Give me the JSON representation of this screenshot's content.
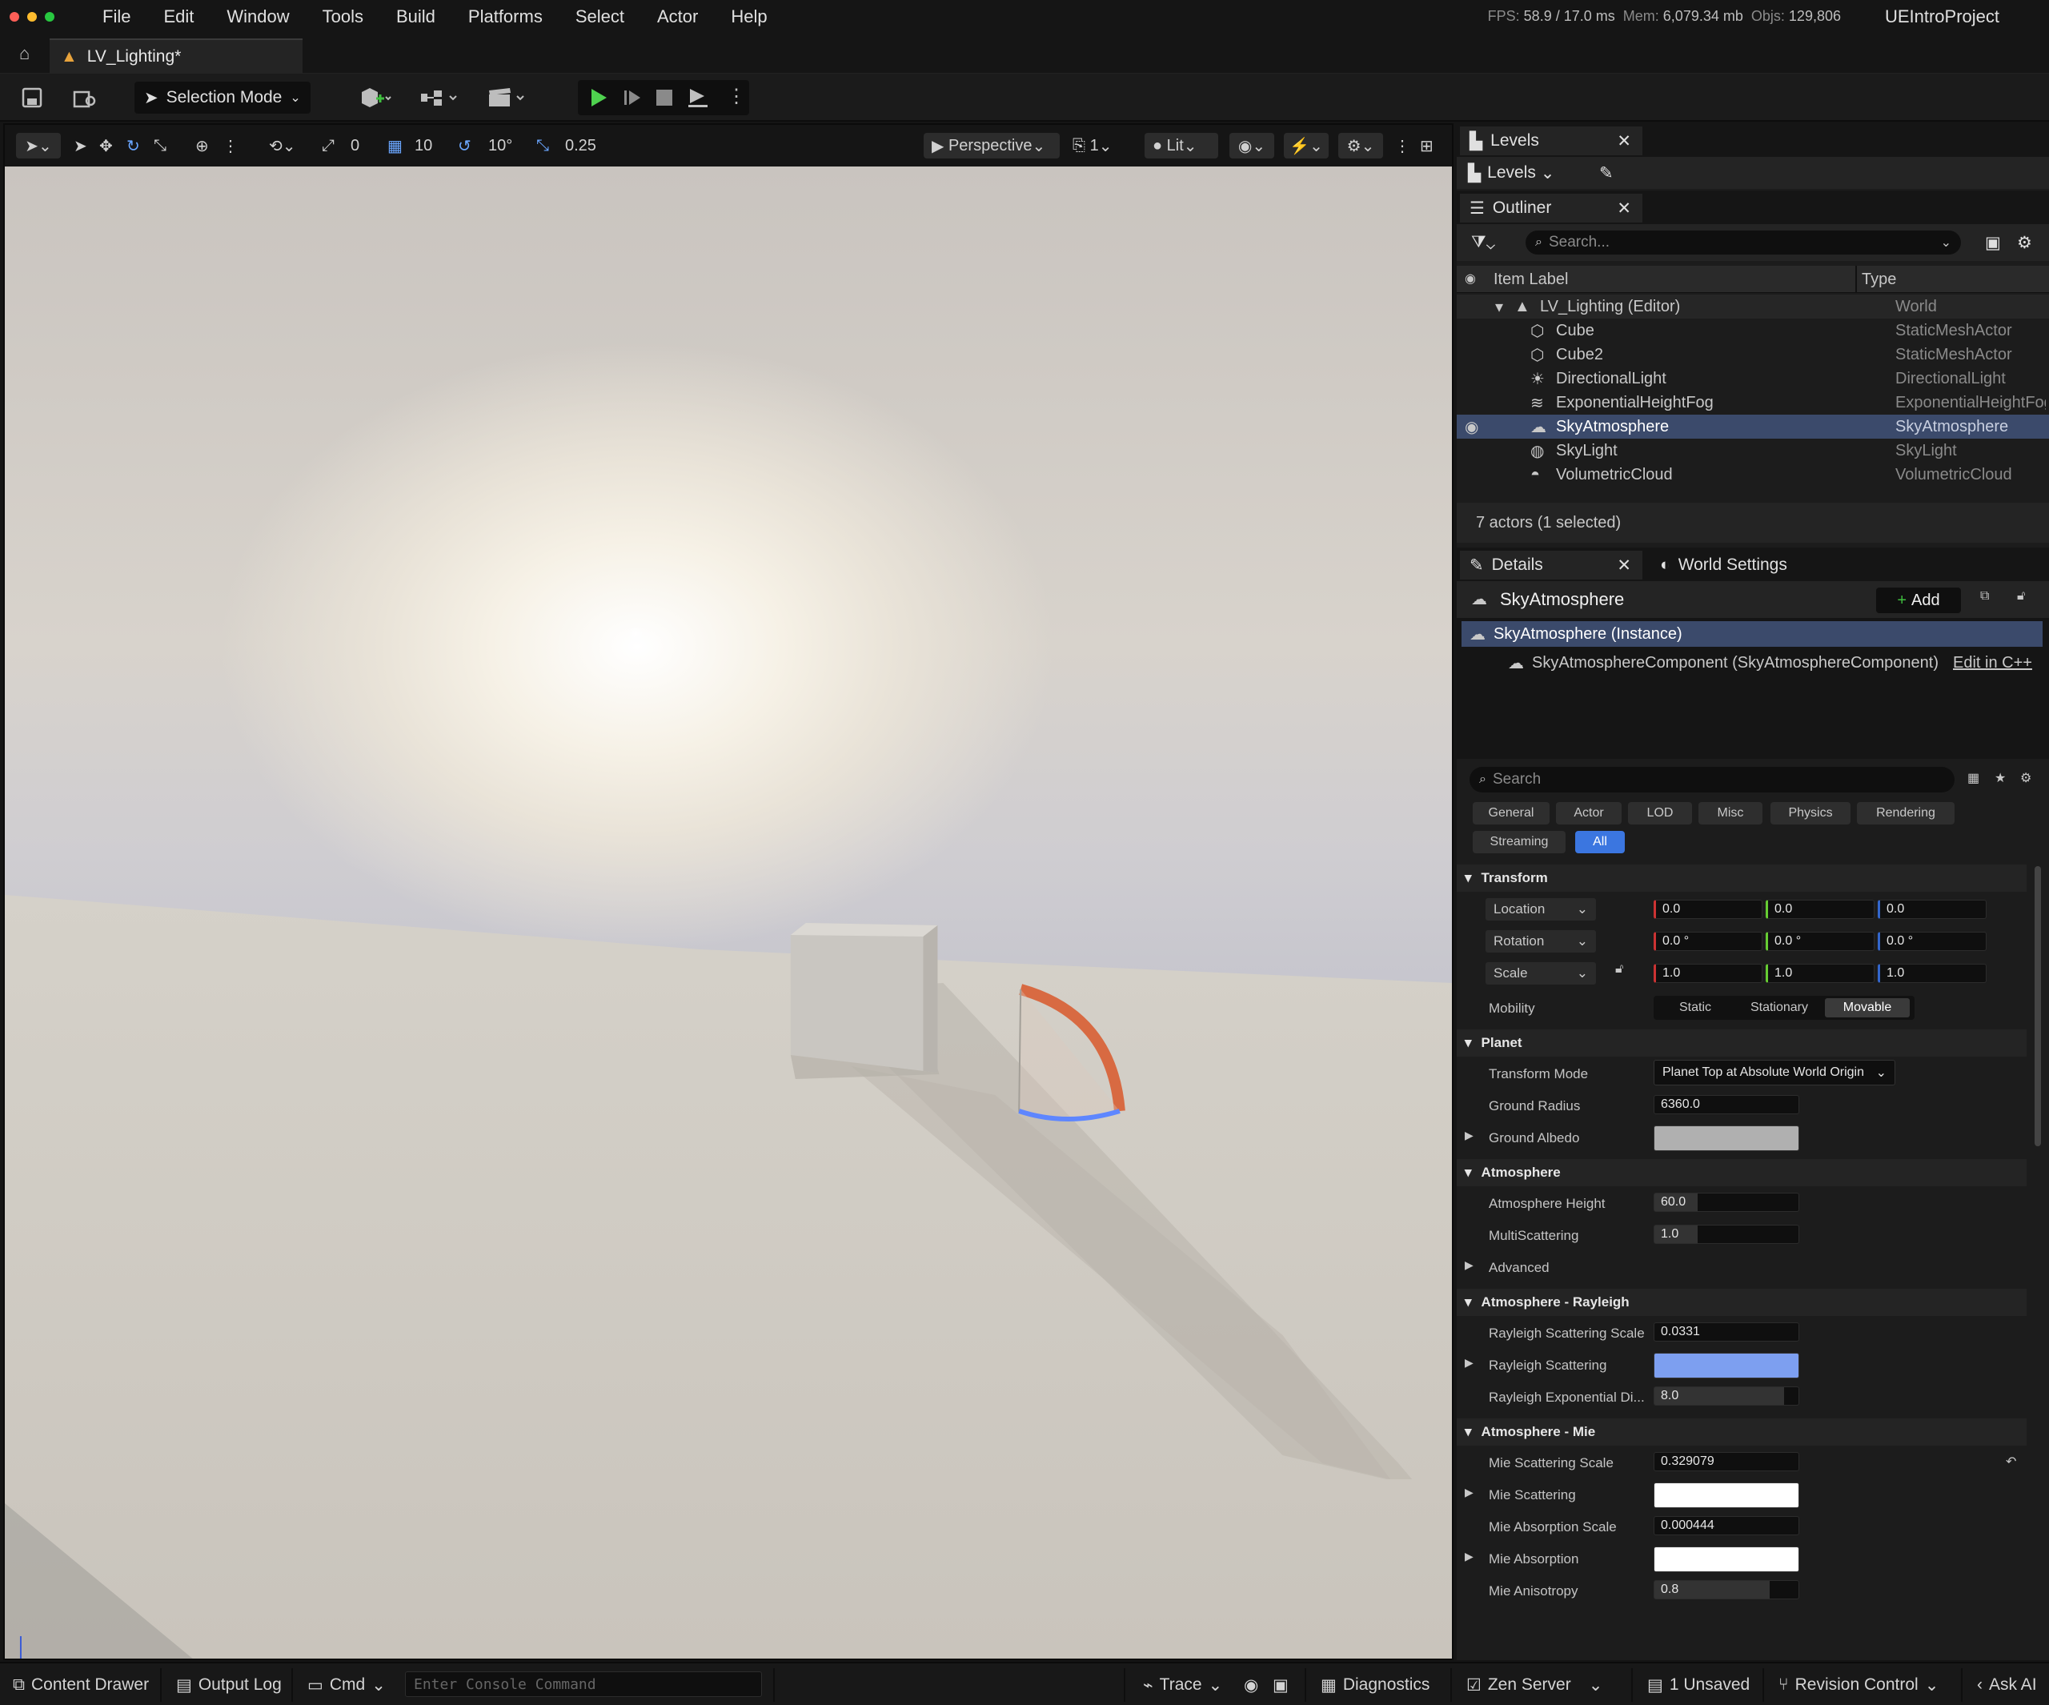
{
  "menu": {
    "items": [
      "File",
      "Edit",
      "Window",
      "Tools",
      "Build",
      "Platforms",
      "Select",
      "Actor",
      "Help"
    ],
    "stats": {
      "fps_label": "FPS:",
      "fps": "58.9",
      "frame": "/ 17.0 ms",
      "mem_label": "Mem:",
      "mem": "6,079.34 mb",
      "objs_label": "Objs:",
      "objs": "129,806"
    },
    "project": "UEIntroProject"
  },
  "tab": {
    "title": "LV_Lighting*"
  },
  "toolbar": {
    "selection_mode": "Selection Mode"
  },
  "viewport": {
    "rot_snap": "0",
    "grid_snap": "10",
    "angle_snap": "10°",
    "scale_snap": "0.25",
    "view_mode": "Perspective",
    "cam_speed": "1",
    "lighting": "Lit"
  },
  "levels": {
    "tab": "Levels",
    "dropdown": "Levels"
  },
  "outliner": {
    "tab": "Outliner",
    "search_placeholder": "Search...",
    "col_label": "Item Label",
    "col_type": "Type",
    "rows": [
      {
        "label": "LV_Lighting (Editor)",
        "type": "World"
      },
      {
        "label": "Cube",
        "type": "StaticMeshActor"
      },
      {
        "label": "Cube2",
        "type": "StaticMeshActor"
      },
      {
        "label": "DirectionalLight",
        "type": "DirectionalLight"
      },
      {
        "label": "ExponentialHeightFog",
        "type": "ExponentialHeightFog"
      },
      {
        "label": "SkyAtmosphere",
        "type": "SkyAtmosphere"
      },
      {
        "label": "SkyLight",
        "type": "SkyLight"
      },
      {
        "label": "VolumetricCloud",
        "type": "VolumetricCloud"
      }
    ],
    "footer": "7 actors (1 selected)"
  },
  "details": {
    "tab": "Details",
    "world_tab": "World Settings",
    "actor": "SkyAtmosphere",
    "add": "Add",
    "instance": "SkyAtmosphere (Instance)",
    "component": "SkyAtmosphereComponent (SkyAtmosphereComponent)",
    "edit_cpp": "Edit in C++",
    "search_placeholder": "Search",
    "filters": [
      "General",
      "Actor",
      "LOD",
      "Misc",
      "Physics",
      "Rendering",
      "Streaming",
      "All"
    ],
    "transform": {
      "title": "Transform",
      "location": "Location",
      "rotation": "Rotation",
      "scale": "Scale",
      "loc": [
        "0.0",
        "0.0",
        "0.0"
      ],
      "rot": [
        "0.0 °",
        "0.0 °",
        "0.0 °"
      ],
      "scl": [
        "1.0",
        "1.0",
        "1.0"
      ],
      "mobility": "Mobility",
      "mob_opts": [
        "Static",
        "Stationary",
        "Movable"
      ]
    },
    "planet": {
      "title": "Planet",
      "transform_mode": "Transform Mode",
      "transform_mode_val": "Planet Top at Absolute World Origin",
      "ground_radius": "Ground Radius",
      "ground_radius_val": "6360.0",
      "ground_albedo": "Ground Albedo"
    },
    "atmosphere": {
      "title": "Atmosphere",
      "height": "Atmosphere Height",
      "height_val": "60.0",
      "multi": "MultiScattering",
      "multi_val": "1.0",
      "advanced": "Advanced"
    },
    "rayleigh": {
      "title": "Atmosphere - Rayleigh",
      "scale": "Rayleigh Scattering Scale",
      "scale_val": "0.0331",
      "scattering": "Rayleigh Scattering",
      "exp": "Rayleigh Exponential Di...",
      "exp_val": "8.0"
    },
    "mie": {
      "title": "Atmosphere - Mie",
      "scale": "Mie Scattering Scale",
      "scale_val": "0.329079",
      "scattering": "Mie Scattering",
      "abs_scale": "Mie Absorption Scale",
      "abs_scale_val": "0.000444",
      "absorption": "Mie Absorption",
      "aniso": "Mie Anisotropy",
      "aniso_val": "0.8"
    },
    "colors": {
      "ground_albedo": "#b0b0b0",
      "rayleigh": "#7d9ff0",
      "mie": "#ffffff",
      "mie_abs": "#ffffff"
    }
  },
  "status": {
    "content_drawer": "Content Drawer",
    "output_log": "Output Log",
    "cmd": "Cmd",
    "console_placeholder": "Enter Console Command",
    "trace": "Trace",
    "diagnostics": "Diagnostics",
    "zen": "Zen Server",
    "unsaved": "1 Unsaved",
    "revision": "Revision Control",
    "ask_ai": "Ask AI"
  }
}
